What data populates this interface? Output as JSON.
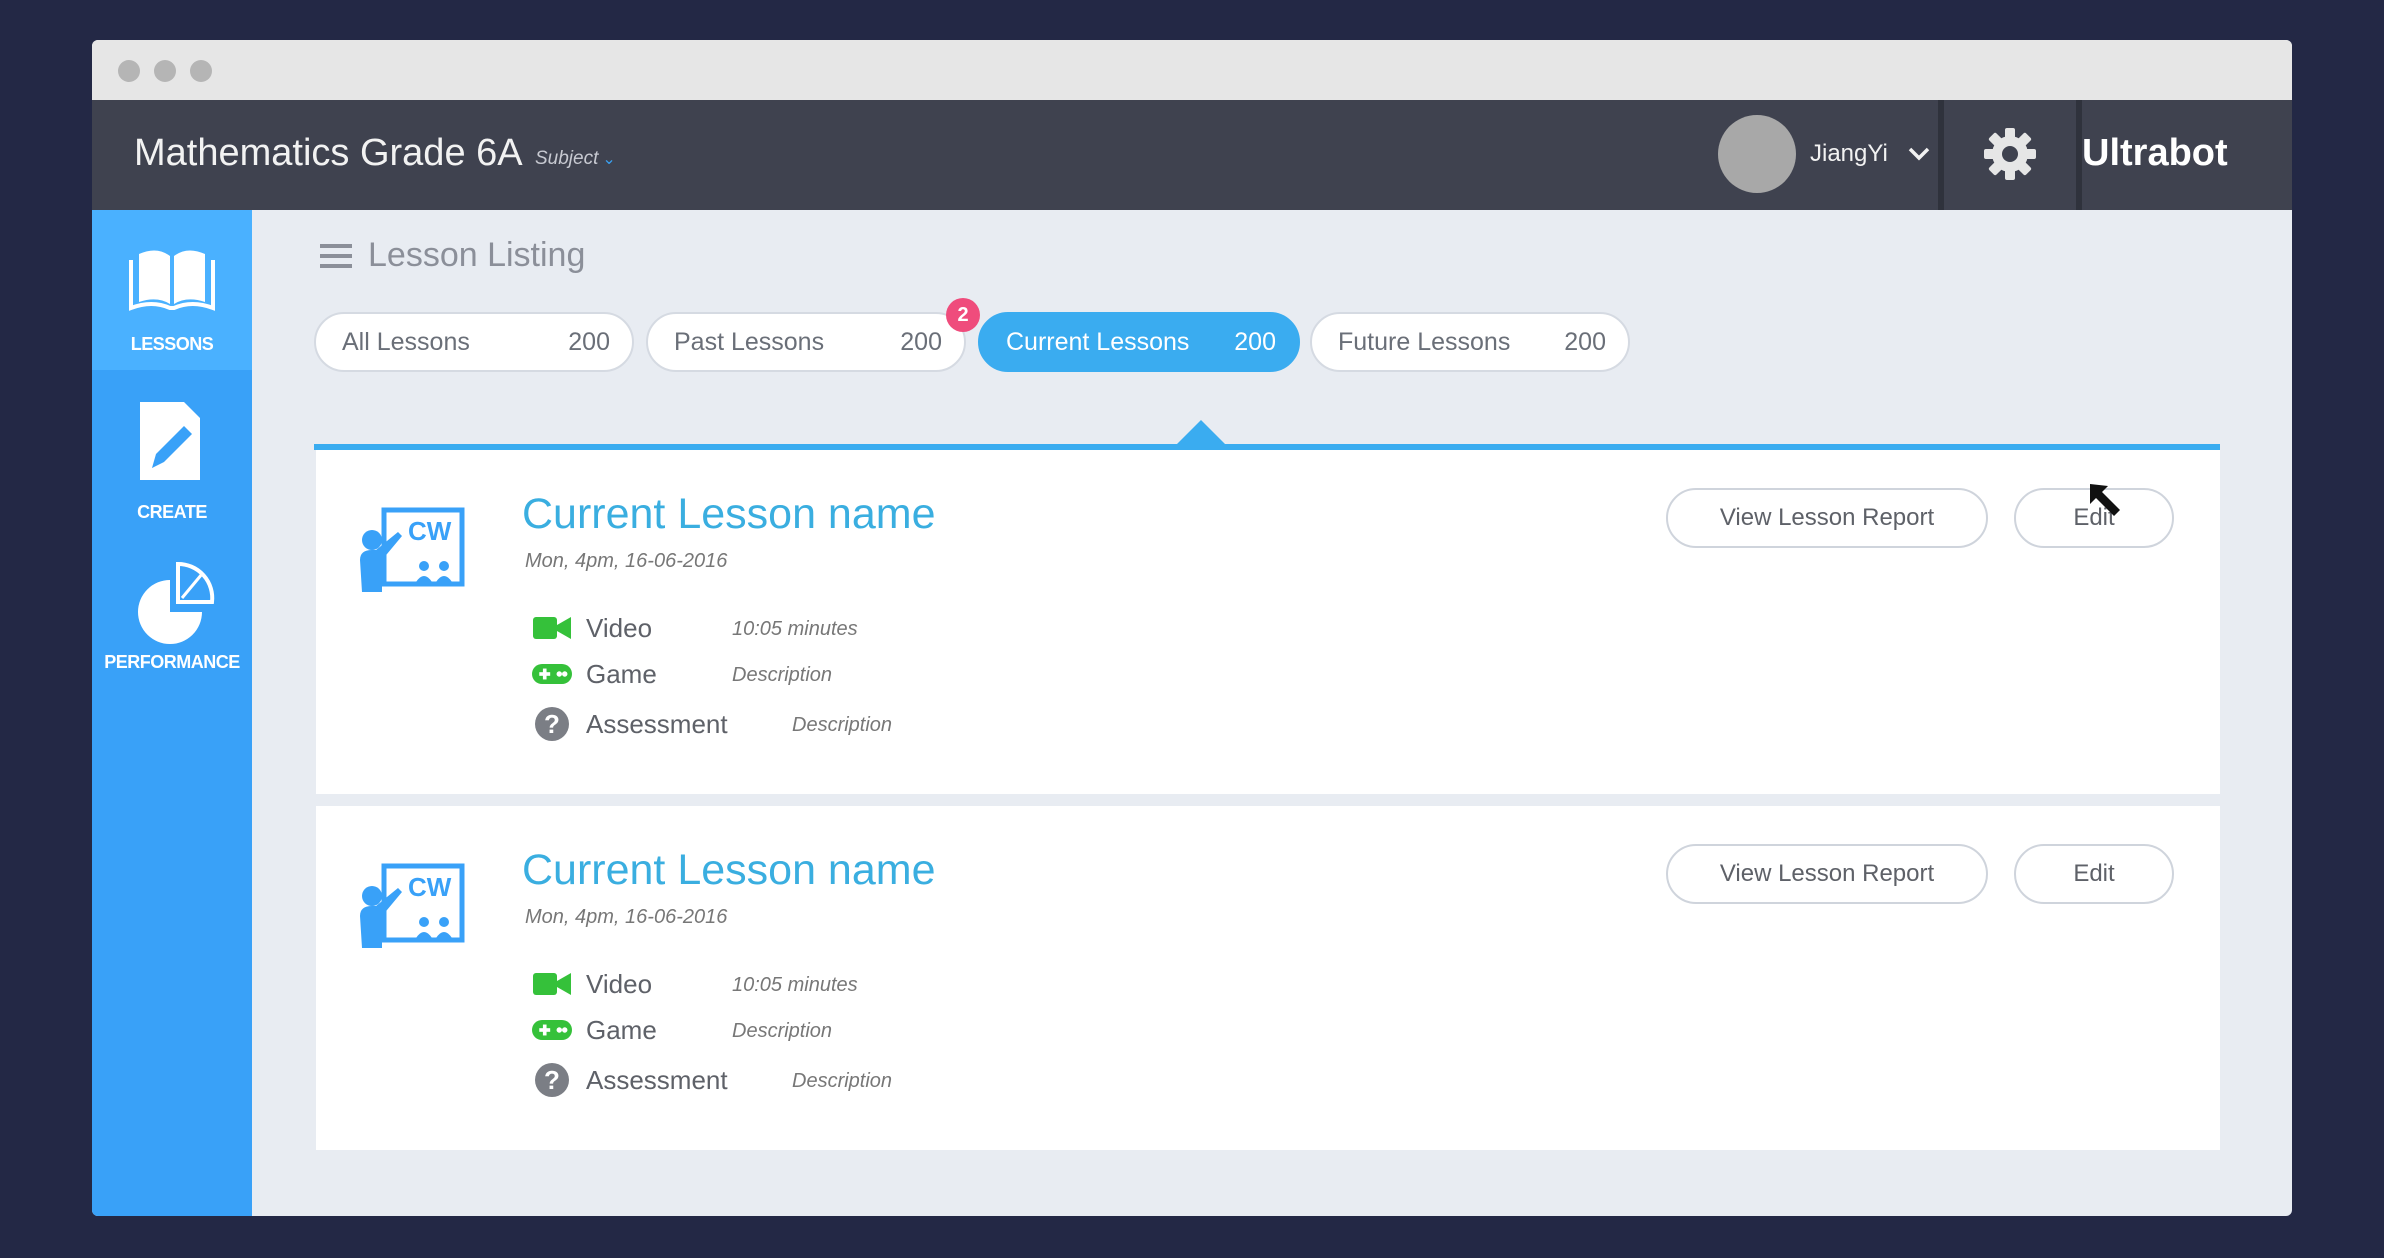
{
  "app": {
    "title": "Mathematics Grade 6A",
    "subject_dropdown": "Subject",
    "brand": "Ultrabot"
  },
  "user": {
    "name": "JiangYi"
  },
  "sidebar": {
    "items": [
      {
        "label": "LESSONS",
        "icon": "book-icon",
        "active": true
      },
      {
        "label": "CREATE",
        "icon": "pencil-icon",
        "active": false
      },
      {
        "label": "PERFORMANCE",
        "icon": "pie-chart-icon",
        "active": false
      }
    ]
  },
  "page": {
    "title": "Lesson Listing"
  },
  "tabs": [
    {
      "label": "All Lessons",
      "count": "200",
      "active": false
    },
    {
      "label": "Past Lessons",
      "count": "200",
      "active": false,
      "badge": "2"
    },
    {
      "label": "Current Lessons",
      "count": "200",
      "active": true
    },
    {
      "label": "Future Lessons",
      "count": "200",
      "active": false
    }
  ],
  "lessons": [
    {
      "name": "Current Lesson name",
      "date": "Mon, 4pm, 16-06-2016",
      "icon_text": "CW",
      "items": [
        {
          "label": "Video",
          "desc": "10:05 minutes"
        },
        {
          "label": "Game",
          "desc": "Description"
        },
        {
          "label": "Assessment",
          "desc": "Description"
        }
      ],
      "report_button": "View Lesson Report",
      "edit_button": "Edit"
    },
    {
      "name": "Current Lesson name",
      "date": "Mon, 4pm, 16-06-2016",
      "icon_text": "CW",
      "items": [
        {
          "label": "Video",
          "desc": "10:05 minutes"
        },
        {
          "label": "Game",
          "desc": "Description"
        },
        {
          "label": "Assessment",
          "desc": "Description"
        }
      ],
      "report_button": "View Lesson Report",
      "edit_button": "Edit"
    }
  ],
  "colors": {
    "background": "#232845",
    "topbar": "#3f424f",
    "sidebar": "#39a1f8",
    "accent": "#3aacf0",
    "badge": "#ef4c7c",
    "lesson_item_icon": "#35c13a"
  }
}
